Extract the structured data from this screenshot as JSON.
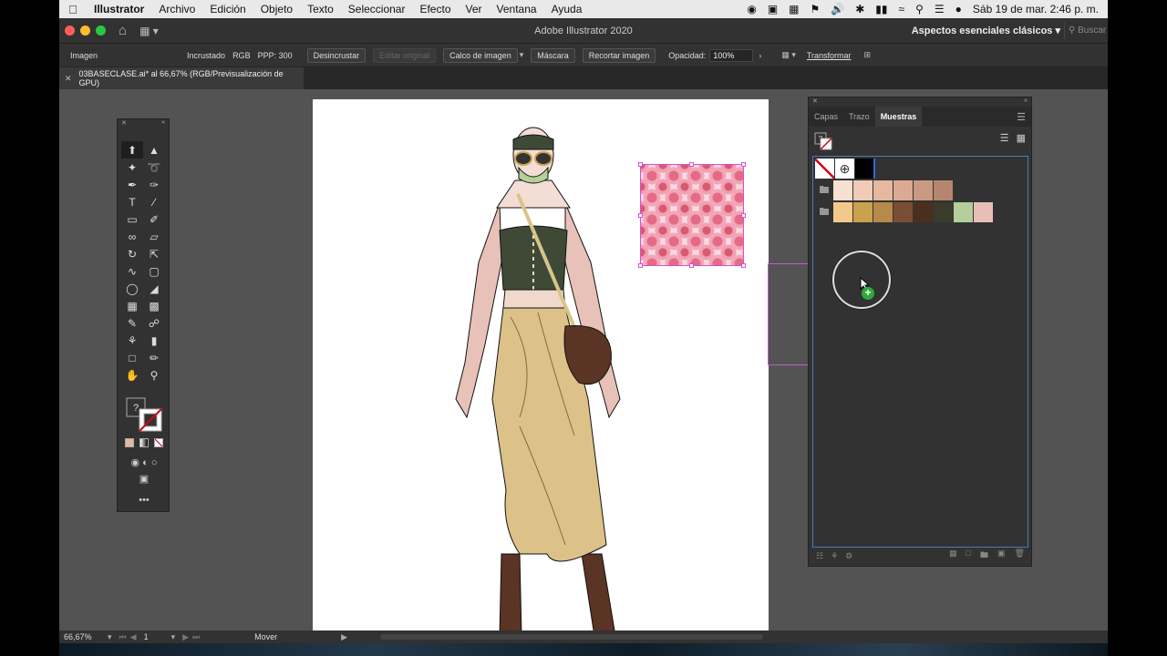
{
  "menubar": {
    "app_name": "Illustrator",
    "items": [
      "Archivo",
      "Edición",
      "Objeto",
      "Texto",
      "Seleccionar",
      "Efecto",
      "Ver",
      "Ventana",
      "Ayuda"
    ],
    "datetime": "Sáb 19 de mar.  2:46 p. m."
  },
  "titlebar": {
    "title": "Adobe Illustrator 2020",
    "workspace": "Aspectos esenciales clásicos",
    "search_placeholder": "Buscar en Adobe Stock"
  },
  "controlbar": {
    "object_type": "Imagen",
    "embedded": "Incrustado",
    "color_mode": "RGB",
    "ppi": "PPP: 300",
    "unembed_label": "Desincrustar",
    "edit_original_label": "Editar original",
    "image_trace_label": "Calco de imagen",
    "mask_label": "Máscara",
    "crop_label": "Recortar imagen",
    "opacity_label": "Opacidad:",
    "opacity_value": "100%",
    "transform_label": "Transformar"
  },
  "document": {
    "tab_title": "03BASECLASE.ai* al 66,67% (RGB/Previsualización de GPU)"
  },
  "swatches_panel": {
    "tabs": [
      "Capas",
      "Trazo",
      "Muestras"
    ],
    "active_tab": "Muestras",
    "row1": [
      "#ffffff",
      "#000000"
    ],
    "group1": [
      "#f7e0d2",
      "#f0cbb5",
      "#e6b8a0",
      "#dcaa94",
      "#c89a84",
      "#b6856f"
    ],
    "group2": [
      "#f2c98b",
      "#c9a24e",
      "#b68a4a",
      "#7a4e34",
      "#4b2f1e",
      "#3a3b2a",
      "#b4cf9a",
      "#e8bfb8"
    ]
  },
  "statusbar": {
    "zoom": "66,67%",
    "page": "1",
    "tool": "Mover"
  },
  "colors": {
    "ui_bg": "#323232",
    "canvas_bg": "#535353",
    "selection": "#d84fd0",
    "panel_focus": "#4a7cb8"
  }
}
